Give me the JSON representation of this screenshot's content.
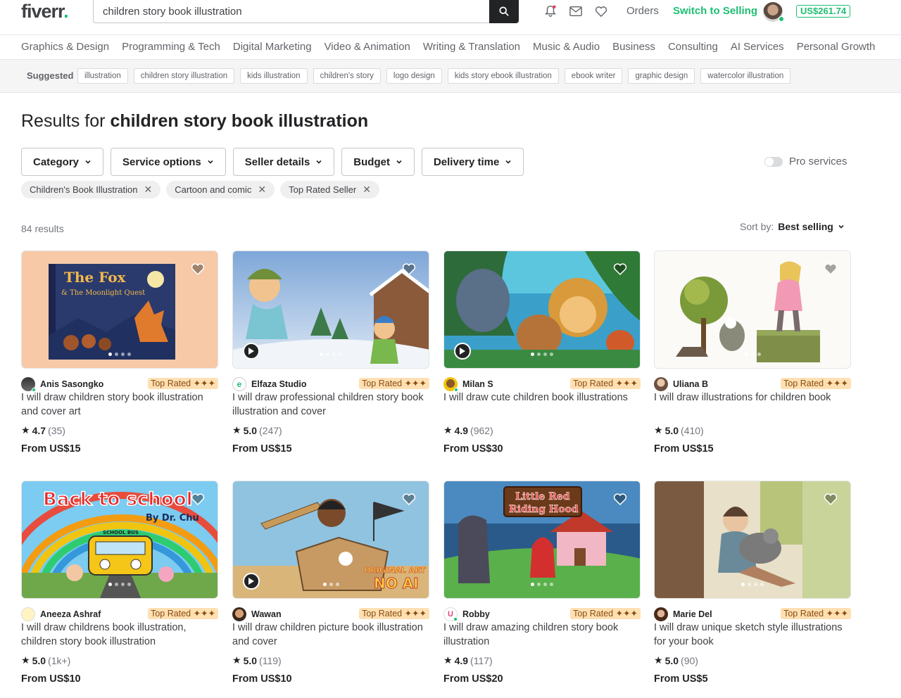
{
  "header": {
    "logo": "fiverr",
    "logo_dot": ".",
    "search_value": "children story book illustration",
    "orders_label": "Orders",
    "switch_label": "Switch to Selling",
    "balance": "US$261.74"
  },
  "categories": [
    "Graphics & Design",
    "Programming & Tech",
    "Digital Marketing",
    "Video & Animation",
    "Writing & Translation",
    "Music & Audio",
    "Business",
    "Consulting",
    "AI Services",
    "Personal Growth"
  ],
  "suggested": {
    "label": "Suggested",
    "items": [
      "illustration",
      "children story illustration",
      "kids illustration",
      "children's story",
      "logo design",
      "kids story ebook illustration",
      "ebook writer",
      "graphic design",
      "watercolor illustration"
    ]
  },
  "results": {
    "prefix": "Results for",
    "query": "children story book illustration",
    "count": "84 results"
  },
  "filters": [
    "Category",
    "Service options",
    "Seller details",
    "Budget",
    "Delivery time"
  ],
  "pro_services_label": "Pro services",
  "active_filters": [
    "Children's Book Illustration",
    "Cartoon and comic",
    "Top Rated Seller"
  ],
  "sort": {
    "label": "Sort by:",
    "value": "Best selling"
  },
  "badge_label": "Top Rated ✦✦✦",
  "gigs": [
    {
      "seller": "Anis Sasongko",
      "title": "I will draw children story book illustration and cover art",
      "rating": "4.7",
      "reviews": "(35)",
      "price": "From US$15",
      "image_text_1": "The Fox",
      "image_text_2": "& The Moonlight Quest"
    },
    {
      "seller": "Elfaza Studio",
      "title": "I will draw professional children story book illustration and cover",
      "rating": "5.0",
      "reviews": "(247)",
      "price": "From US$15"
    },
    {
      "seller": "Milan S",
      "title": "I will draw cute children book illustrations",
      "rating": "4.9",
      "reviews": "(962)",
      "price": "From US$30"
    },
    {
      "seller": "Uliana B",
      "title": "I will draw illustrations for children book",
      "rating": "5.0",
      "reviews": "(410)",
      "price": "From US$15"
    },
    {
      "seller": "Aneeza Ashraf",
      "title": "I will draw childrens book illustration, children story book illustration",
      "rating": "5.0",
      "reviews": "(1k+)",
      "price": "From US$10",
      "image_text_1": "Back to school",
      "image_text_2": "By Dr. Chu",
      "image_text_3": "SCHOOL BUS"
    },
    {
      "seller": "Wawan",
      "title": "I will draw children picture book illustration and cover",
      "rating": "5.0",
      "reviews": "(119)",
      "price": "From US$10",
      "image_text_1": "ORIGINAL ART",
      "image_text_2": "NO AI"
    },
    {
      "seller": "Robby",
      "title": "I will draw amazing children story book illustration",
      "rating": "4.9",
      "reviews": "(117)",
      "price": "From US$20",
      "image_text_1": "Little Red",
      "image_text_2": "Riding Hood"
    },
    {
      "seller": "Marie Del",
      "title": "I will draw unique sketch style illustrations for your book",
      "rating": "5.0",
      "reviews": "(90)",
      "price": "From US$5"
    }
  ]
}
